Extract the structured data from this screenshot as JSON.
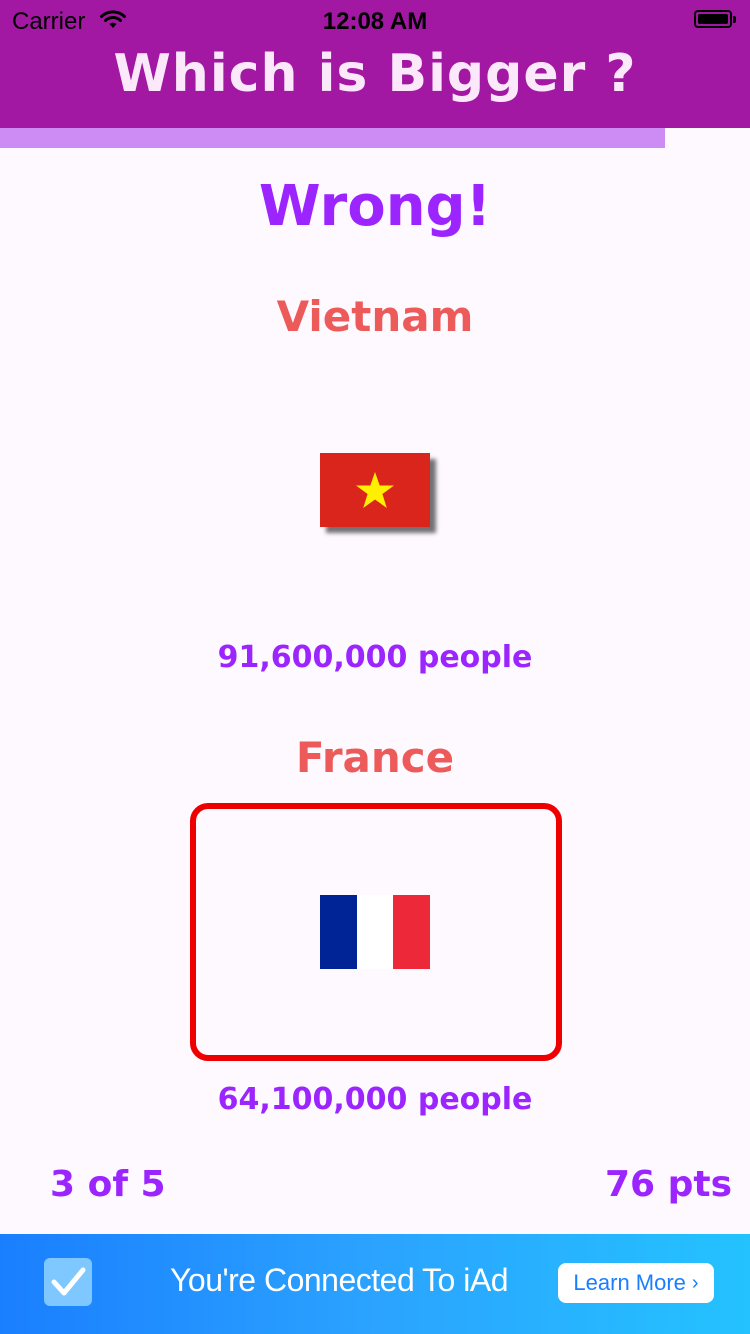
{
  "status_bar": {
    "carrier": "Carrier",
    "time": "12:08 AM",
    "wifi_icon": "wifi-icon",
    "battery_icon": "battery-icon"
  },
  "header": {
    "title": "Which is Bigger ?",
    "background": "#a218a2"
  },
  "progress": {
    "fraction": 0.887,
    "color": "#cc8cf3"
  },
  "result": {
    "text": "Wrong!"
  },
  "options": [
    {
      "country": "Vietnam",
      "flag": "vietnam-flag",
      "population": "91,600,000 people"
    },
    {
      "country": "France",
      "flag": "france-flag",
      "population": "64,100,000 people",
      "highlighted": true
    }
  ],
  "footer": {
    "question_counter": "3 of 5",
    "score": "76 pts"
  },
  "ad": {
    "text": "You're Connected To iAd",
    "button_label": "Learn More",
    "check_icon": "checkmark-icon"
  },
  "colors": {
    "accent": "#9b24ff",
    "country_name": "#ec5a5a",
    "highlight_border": "#ef0000"
  }
}
